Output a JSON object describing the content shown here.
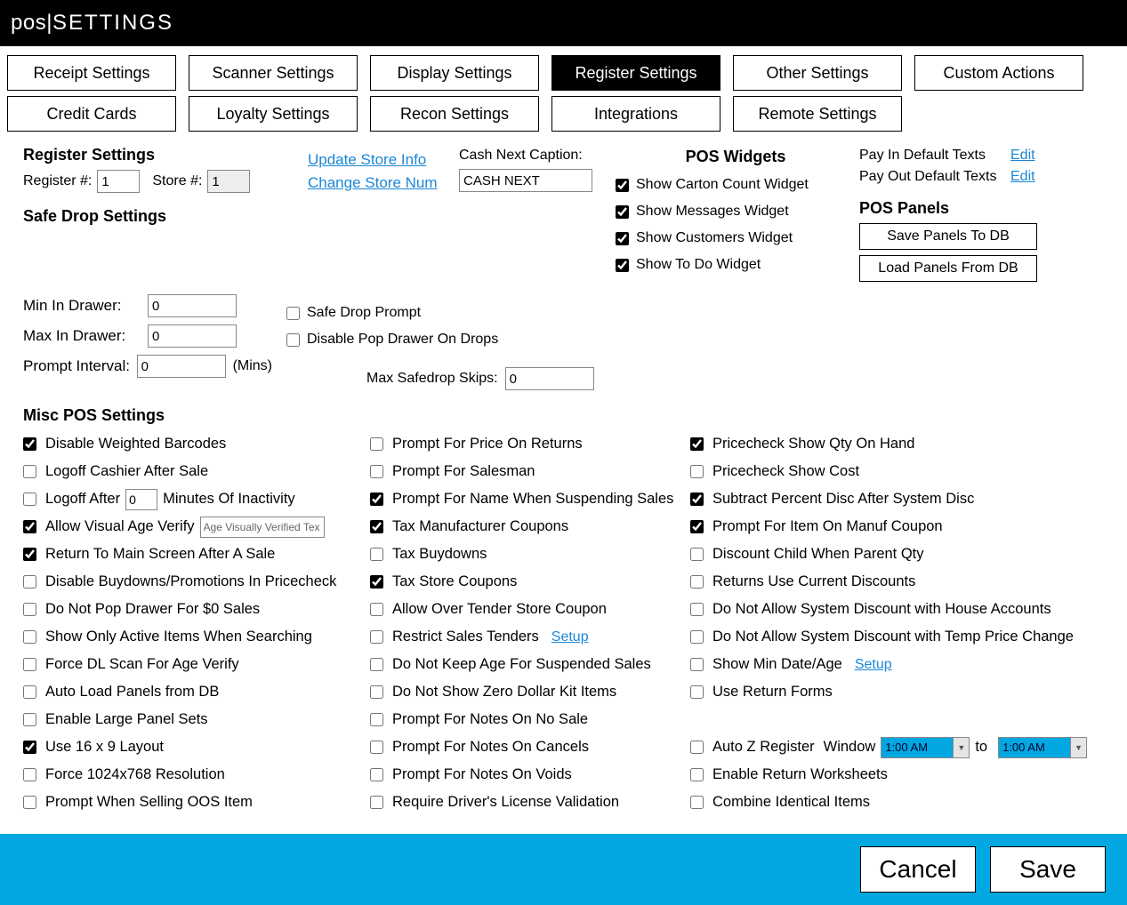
{
  "title_prefix": "pos",
  "title_sep": " | ",
  "title_suffix": "SETTINGS",
  "tabs_row1": [
    "Receipt Settings",
    "Scanner Settings",
    "Display Settings",
    "Register Settings",
    "Other Settings",
    "Custom Actions"
  ],
  "tabs_row2": [
    "Credit Cards",
    "Loyalty Settings",
    "Recon Settings",
    "Integrations",
    "Remote Settings"
  ],
  "active_tab": "Register Settings",
  "register": {
    "heading": "Register Settings",
    "reg_label": "Register #:",
    "reg_value": "1",
    "store_label": "Store #:",
    "store_value": "1",
    "update_link": "Update Store Info",
    "change_link": "Change Store Num",
    "cash_caption_label": "Cash Next Caption:",
    "cash_caption_value": "CASH NEXT"
  },
  "widgets": {
    "heading": "POS Widgets",
    "items": [
      {
        "label": "Show Carton Count Widget",
        "checked": true
      },
      {
        "label": "Show Messages Widget",
        "checked": true
      },
      {
        "label": "Show Customers Widget",
        "checked": true
      },
      {
        "label": "Show To Do Widget",
        "checked": true
      }
    ]
  },
  "right_panel": {
    "payin_label": "Pay In Default Texts",
    "payout_label": "Pay Out Default Texts",
    "edit_text": "Edit",
    "panels_heading": "POS Panels",
    "save_btn": "Save Panels To DB",
    "load_btn": "Load Panels From DB"
  },
  "safedrop": {
    "heading": "Safe Drop Settings",
    "min_label": "Min In Drawer:",
    "min_value": "0",
    "max_label": "Max In Drawer:",
    "max_value": "0",
    "prompt_label": "Prompt Interval:",
    "prompt_value": "0",
    "mins_text": "(Mins)",
    "sd_prompt": {
      "label": "Safe Drop Prompt",
      "checked": false
    },
    "sd_disable": {
      "label": "Disable Pop Drawer On Drops",
      "checked": false
    },
    "skips_label": "Max Safedrop Skips:",
    "skips_value": "0"
  },
  "misc_heading": "Misc POS Settings",
  "logoff_minutes_value": "0",
  "logoff_minutes_suffix": "Minutes Of Inactivity",
  "age_verify_text_value": "Age Visually Verified Tex",
  "setup_text": "Setup",
  "col1": [
    {
      "label": "Disable Weighted Barcodes",
      "checked": true,
      "kind": "plain"
    },
    {
      "label": "Logoff Cashier After Sale",
      "checked": false,
      "kind": "plain"
    },
    {
      "label": "Logoff After",
      "checked": false,
      "kind": "logoff"
    },
    {
      "label": "Allow Visual Age Verify",
      "checked": true,
      "kind": "ageverify"
    },
    {
      "label": "Return To Main Screen After A Sale",
      "checked": true,
      "kind": "plain"
    },
    {
      "label": "Disable Buydowns/Promotions In Pricecheck",
      "checked": false,
      "kind": "plain"
    },
    {
      "label": "Do Not Pop Drawer For $0 Sales",
      "checked": false,
      "kind": "plain"
    },
    {
      "label": "Show Only Active Items When Searching",
      "checked": false,
      "kind": "plain"
    },
    {
      "label": "Force DL Scan For Age Verify",
      "checked": false,
      "kind": "plain"
    },
    {
      "label": "Auto Load Panels from DB",
      "checked": false,
      "kind": "plain"
    },
    {
      "label": "Enable Large Panel Sets",
      "checked": false,
      "kind": "plain"
    },
    {
      "label": "Use 16 x 9 Layout",
      "checked": true,
      "kind": "plain"
    },
    {
      "label": "Force 1024x768 Resolution",
      "checked": false,
      "kind": "plain"
    },
    {
      "label": "Prompt When Selling OOS Item",
      "checked": false,
      "kind": "plain"
    }
  ],
  "col2": [
    {
      "label": "Prompt For Price On Returns",
      "checked": false,
      "kind": "plain"
    },
    {
      "label": "Prompt For Salesman",
      "checked": false,
      "kind": "plain"
    },
    {
      "label": "Prompt For Name When Suspending Sales",
      "checked": true,
      "kind": "plain"
    },
    {
      "label": "Tax Manufacturer Coupons",
      "checked": true,
      "kind": "plain"
    },
    {
      "label": "Tax Buydowns",
      "checked": false,
      "kind": "plain"
    },
    {
      "label": "Tax Store Coupons",
      "checked": true,
      "kind": "plain"
    },
    {
      "label": "Allow Over Tender Store Coupon",
      "checked": false,
      "kind": "plain"
    },
    {
      "label": "Restrict Sales Tenders",
      "checked": false,
      "kind": "setup"
    },
    {
      "label": "Do Not Keep Age For Suspended Sales",
      "checked": false,
      "kind": "plain"
    },
    {
      "label": "Do Not Show Zero Dollar Kit Items",
      "checked": false,
      "kind": "plain"
    },
    {
      "label": "Prompt For Notes On No Sale",
      "checked": false,
      "kind": "plain"
    },
    {
      "label": "Prompt For Notes On Cancels",
      "checked": false,
      "kind": "plain"
    },
    {
      "label": "Prompt For Notes On Voids",
      "checked": false,
      "kind": "plain"
    },
    {
      "label": "Require Driver's License Validation",
      "checked": false,
      "kind": "plain"
    }
  ],
  "col3": [
    {
      "label": "Pricecheck Show Qty On Hand",
      "checked": true,
      "kind": "plain"
    },
    {
      "label": "Pricecheck Show Cost",
      "checked": false,
      "kind": "plain"
    },
    {
      "label": "Subtract Percent Disc After System Disc",
      "checked": true,
      "kind": "plain"
    },
    {
      "label": "Prompt For Item On Manuf Coupon",
      "checked": true,
      "kind": "plain"
    },
    {
      "label": "Discount Child When Parent Qty",
      "checked": false,
      "kind": "plain"
    },
    {
      "label": "Returns Use Current Discounts",
      "checked": false,
      "kind": "plain"
    },
    {
      "label": "Do Not Allow System Discount with House Accounts",
      "checked": false,
      "kind": "plain"
    },
    {
      "label": "Do Not Allow System Discount with Temp Price Change",
      "checked": false,
      "kind": "plain"
    },
    {
      "label": "Show Min Date/Age",
      "checked": false,
      "kind": "setup"
    },
    {
      "label": "Use Return Forms",
      "checked": false,
      "kind": "plain"
    },
    {
      "label": "",
      "checked": false,
      "kind": "spacer"
    },
    {
      "label": "Auto Z Register",
      "checked": false,
      "kind": "timewindow"
    },
    {
      "label": "Enable Return Worksheets",
      "checked": false,
      "kind": "plain"
    },
    {
      "label": "Combine Identical Items",
      "checked": false,
      "kind": "plain"
    }
  ],
  "time_window": {
    "window_label": "Window",
    "from_value": "1:00 AM",
    "to_text": "to",
    "to_value": "1:00 AM"
  },
  "footer": {
    "cancel": "Cancel",
    "save": "Save"
  }
}
